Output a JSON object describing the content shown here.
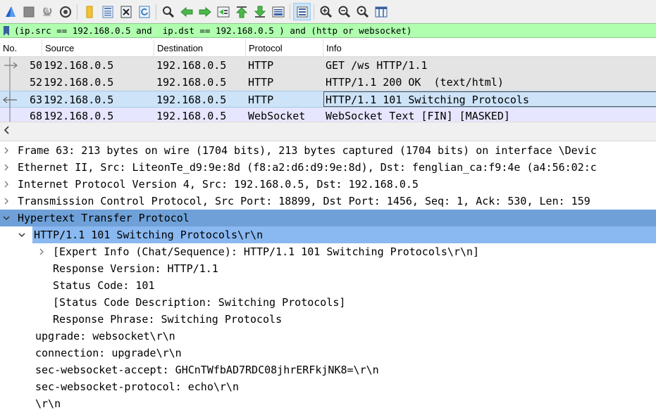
{
  "toolbar": {
    "buttons": [
      {
        "name": "shark-fin-start-icon",
        "color": "#1e64c8"
      },
      {
        "name": "stop-capture-icon",
        "color": "#808080"
      },
      {
        "name": "restart-capture-icon",
        "color": "#9a9a9a"
      },
      {
        "name": "capture-options-gear-icon",
        "color": "#555555"
      },
      {
        "name": "open-file-icon",
        "color": "#e8b923"
      },
      {
        "name": "save-file-icon",
        "color": "#5a7fb5"
      },
      {
        "name": "close-file-icon",
        "color": "#3a3a3a"
      },
      {
        "name": "reload-file-icon",
        "color": "#3a7fc2"
      },
      {
        "name": "find-packet-icon",
        "color": "#333333"
      },
      {
        "name": "go-back-icon",
        "color": "#3cae3c"
      },
      {
        "name": "go-forward-icon",
        "color": "#3cae3c"
      },
      {
        "name": "go-to-packet-icon",
        "color": "#3cae3c"
      },
      {
        "name": "go-first-packet-icon",
        "color": "#3cae3c"
      },
      {
        "name": "go-last-packet-icon",
        "color": "#3cae3c"
      },
      {
        "name": "auto-scroll-icon",
        "color": "#3a5fa0"
      },
      {
        "name": "colorize-icon",
        "color": "#3a5fa0"
      },
      {
        "name": "zoom-in-icon",
        "color": "#333333"
      },
      {
        "name": "zoom-out-icon",
        "color": "#333333"
      },
      {
        "name": "zoom-normal-icon",
        "color": "#333333"
      },
      {
        "name": "resize-columns-icon",
        "color": "#3a5fa0"
      }
    ]
  },
  "filter": {
    "expression": "(ip.src == 192.168.0.5 and  ip.dst == 192.168.0.5 ) and (http or websocket)"
  },
  "packet_list": {
    "columns": [
      "No.",
      "Source",
      "Destination",
      "Protocol",
      "Info"
    ],
    "rows": [
      {
        "no": "50",
        "source": "192.168.0.5",
        "destination": "192.168.0.5",
        "protocol": "HTTP",
        "info": "GET /ws HTTP/1.1",
        "style": "http"
      },
      {
        "no": "52",
        "source": "192.168.0.5",
        "destination": "192.168.0.5",
        "protocol": "HTTP",
        "info": "HTTP/1.1 200 OK  (text/html)",
        "style": "http"
      },
      {
        "no": "63",
        "source": "192.168.0.5",
        "destination": "192.168.0.5",
        "protocol": "HTTP",
        "info": "HTTP/1.1 101 Switching Protocols",
        "style": "selected"
      },
      {
        "no": "68",
        "source": "192.168.0.5",
        "destination": "192.168.0.5",
        "protocol": "WebSocket",
        "info": "WebSocket Text [FIN] [MASKED]",
        "style": "ws"
      }
    ]
  },
  "details": [
    {
      "text": "Frame 63: 213 bytes on wire (1704 bits), 213 bytes captured (1704 bits) on interface \\Devic",
      "arrow": "collapsed",
      "level": 0,
      "hl": ""
    },
    {
      "text": "Ethernet II, Src: LiteonTe_d9:9e:8d (f8:a2:d6:d9:9e:8d), Dst: fenglian_ca:f9:4e (a4:56:02:c",
      "arrow": "collapsed",
      "level": 0,
      "hl": ""
    },
    {
      "text": "Internet Protocol Version 4, Src: 192.168.0.5, Dst: 192.168.0.5",
      "arrow": "collapsed",
      "level": 0,
      "hl": ""
    },
    {
      "text": "Transmission Control Protocol, Src Port: 18899, Dst Port: 1456, Seq: 1, Ack: 530, Len: 159",
      "arrow": "collapsed",
      "level": 0,
      "hl": ""
    },
    {
      "text": "Hypertext Transfer Protocol",
      "arrow": "expanded",
      "level": 0,
      "hl": "dark"
    },
    {
      "text": "HTTP/1.1 101 Switching Protocols\\r\\n",
      "arrow": "expanded",
      "level": 1,
      "hl": "light"
    },
    {
      "text": "[Expert Info (Chat/Sequence): HTTP/1.1 101 Switching Protocols\\r\\n]",
      "arrow": "collapsed",
      "level": 2,
      "hl": ""
    },
    {
      "text": "Response Version: HTTP/1.1",
      "arrow": "",
      "level": 2,
      "hl": ""
    },
    {
      "text": "Status Code: 101",
      "arrow": "",
      "level": 2,
      "hl": ""
    },
    {
      "text": "[Status Code Description: Switching Protocols]",
      "arrow": "",
      "level": 2,
      "hl": ""
    },
    {
      "text": "Response Phrase: Switching Protocols",
      "arrow": "",
      "level": 2,
      "hl": ""
    },
    {
      "text": "upgrade: websocket\\r\\n",
      "arrow": "",
      "level": 1,
      "hl": ""
    },
    {
      "text": "connection: upgrade\\r\\n",
      "arrow": "",
      "level": 1,
      "hl": ""
    },
    {
      "text": "sec-websocket-accept: GHCnTWfbAD7RDC08jhrERFkjNK8=\\r\\n",
      "arrow": "",
      "level": 1,
      "hl": ""
    },
    {
      "text": "sec-websocket-protocol: echo\\r\\n",
      "arrow": "",
      "level": 1,
      "hl": ""
    },
    {
      "text": "\\r\\n",
      "arrow": "",
      "level": 1,
      "hl": ""
    }
  ]
}
